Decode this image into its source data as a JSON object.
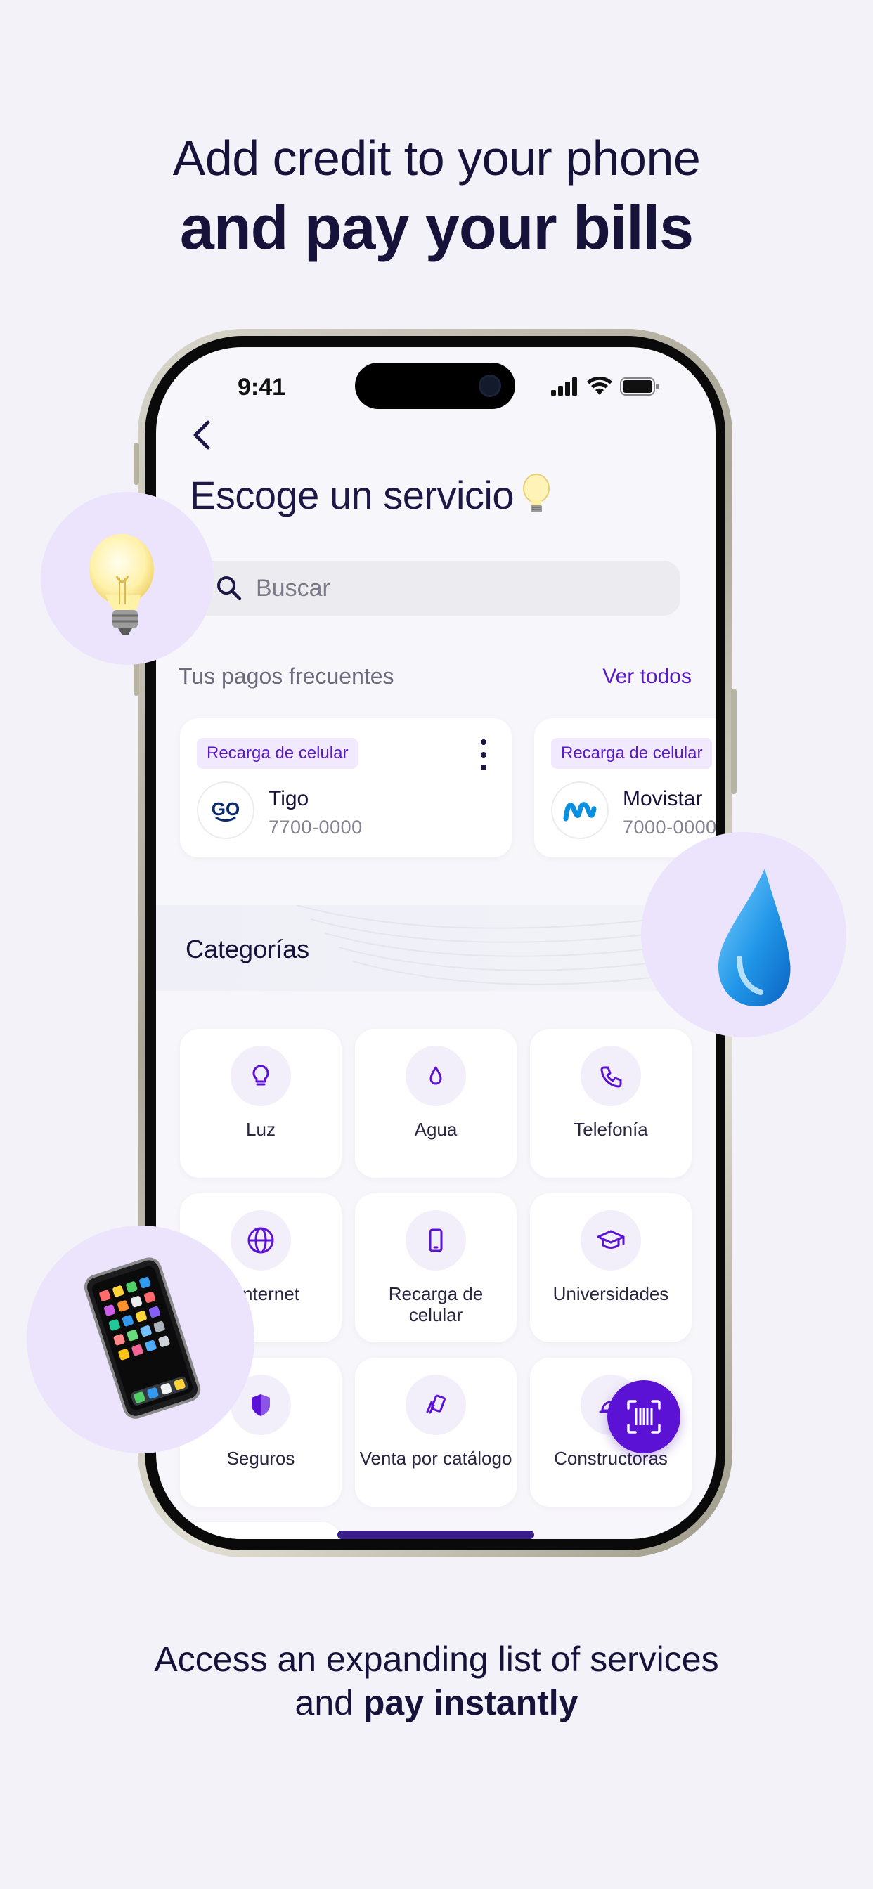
{
  "headline": {
    "line1": "Add credit to your phone",
    "line2": "and pay your bills"
  },
  "footer": {
    "line1": "Access an expanding list of services",
    "line2_prefix": "and ",
    "line2_bold": "pay instantly"
  },
  "status_bar": {
    "time": "9:41",
    "icons": [
      "signal-icon",
      "wifi-icon",
      "battery-icon"
    ]
  },
  "screen": {
    "back_icon": "chevron-left-icon",
    "title": "Escoge un servicio",
    "title_emoji": "light-bulb-icon",
    "search": {
      "placeholder": "Buscar",
      "value": ""
    },
    "frequent": {
      "title": "Tus pagos frecuentes",
      "see_all": "Ver todos",
      "items": [
        {
          "tag": "Recarga de celular",
          "name": "Tigo",
          "number": "7700-0000",
          "logo": "tigo-logo-icon"
        },
        {
          "tag": "Recarga de celular",
          "name": "Movistar",
          "number": "7000-0000",
          "logo": "movistar-logo-icon"
        }
      ]
    },
    "categories": {
      "title": "Categorías",
      "items": [
        {
          "label": "Luz",
          "icon": "lightbulb-icon"
        },
        {
          "label": "Agua",
          "icon": "water-drop-icon"
        },
        {
          "label": "Telefonía",
          "icon": "phone-icon"
        },
        {
          "label": "e Internet",
          "icon": "globe-icon"
        },
        {
          "label": "Recarga de celular",
          "icon": "mobile-icon"
        },
        {
          "label": "Universidades",
          "icon": "graduation-cap-icon"
        },
        {
          "label": "Seguros",
          "icon": "shield-icon"
        },
        {
          "label": "Venta por catálogo",
          "icon": "catalog-icon"
        },
        {
          "label": "Constructoras",
          "icon": "helmet-icon"
        }
      ]
    },
    "fab_icon": "barcode-scan-icon"
  },
  "decorations": [
    "light-bulb-emoji",
    "water-drop-emoji",
    "mobile-phone-emoji"
  ],
  "colors": {
    "accent": "#5b12d4",
    "link": "#5b1bc4",
    "tag_bg": "#f1e9fd",
    "bubble": "#ece3fc",
    "background": "#f3f2f8"
  }
}
